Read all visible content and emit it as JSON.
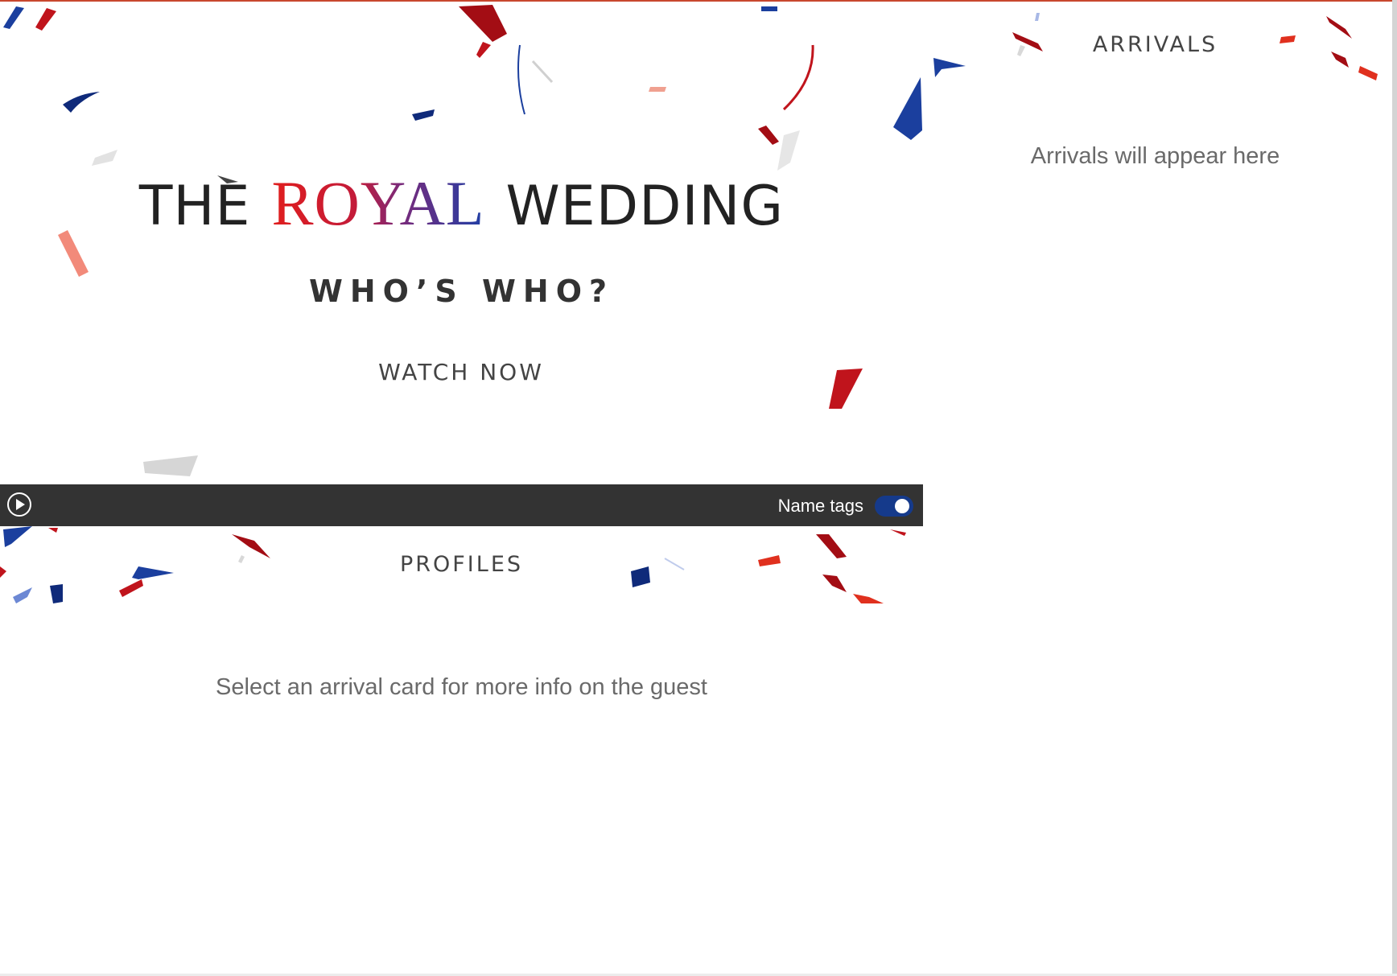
{
  "hero": {
    "title_prefix": "THE",
    "title_highlight": "ROYAL",
    "title_suffix": "WEDDING",
    "subtitle": "WHO’S WHO?",
    "watch_now": "WATCH NOW",
    "royal_gradient": [
      "#e01e1e",
      "#7a2a7a",
      "#1f3fa6"
    ]
  },
  "video_bar": {
    "play_icon": "play-circle-icon",
    "name_tags_label": "Name tags",
    "name_tags_enabled": true,
    "toggle_color": "#153a8b"
  },
  "profiles": {
    "heading": "PROFILES",
    "empty_message": "Select an arrival card for more info on the guest"
  },
  "arrivals": {
    "heading": "ARRIVALS",
    "empty_message": "Arrivals will appear here"
  },
  "theme": {
    "confetti_red": "#c0141c",
    "confetti_blue": "#1b3f9e",
    "confetti_grey": "#d6d6d6",
    "accent_rule": "#c8472e"
  }
}
